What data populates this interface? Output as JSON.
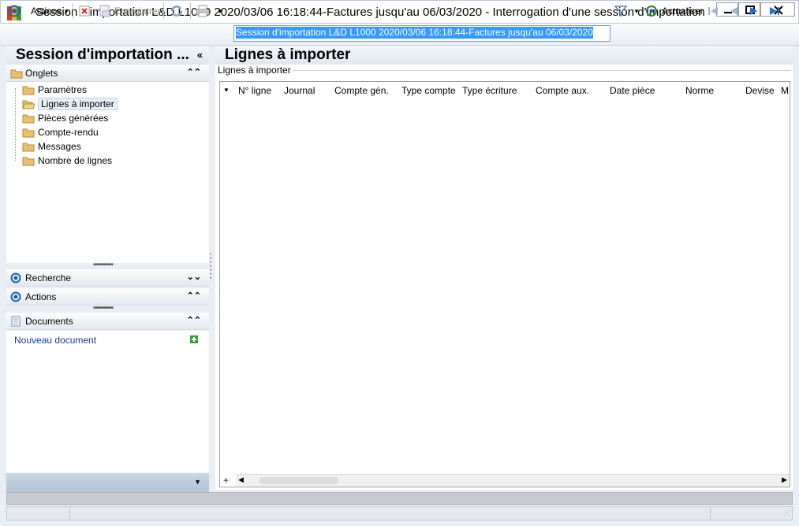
{
  "window": {
    "title": "Session d'importation L&D L1000 2020/03/06 16:18:44-Factures jusqu'au 06/03/2020 -  Interrogation d'une session d'importation"
  },
  "toolbar": {
    "actions_label": "Actions",
    "save_label": "Enregistrer",
    "session_value": "Session d'importation L&D L1000 2020/03/06 16:18:44-Factures jusqu'au 06/03/2020",
    "refresh_label": "Actualiser"
  },
  "left_panel": {
    "title": "Session d'importation ...",
    "onglets": {
      "label": "Onglets",
      "items": [
        {
          "label": "Paramètres"
        },
        {
          "label": "Lignes à importer"
        },
        {
          "label": "Pièces générées"
        },
        {
          "label": "Compte-rendu"
        },
        {
          "label": "Messages"
        },
        {
          "label": "Nombre de lignes"
        }
      ]
    },
    "recherche_label": "Recherche",
    "actions_label": "Actions",
    "documents_label": "Documents",
    "new_document_label": "Nouveau document"
  },
  "main": {
    "title": "Lignes à importer",
    "group_label": "Lignes à importer",
    "columns": [
      "N° ligne",
      "Journal",
      "Compte gén.",
      "Type compte",
      "Type écriture",
      "Compte aux.",
      "Date pièce",
      "Norme",
      "Devise",
      "M"
    ]
  },
  "colors": {
    "selection": "#3399ff",
    "accent_blue": "#1f5fb4",
    "link": "#1a3a8f"
  }
}
